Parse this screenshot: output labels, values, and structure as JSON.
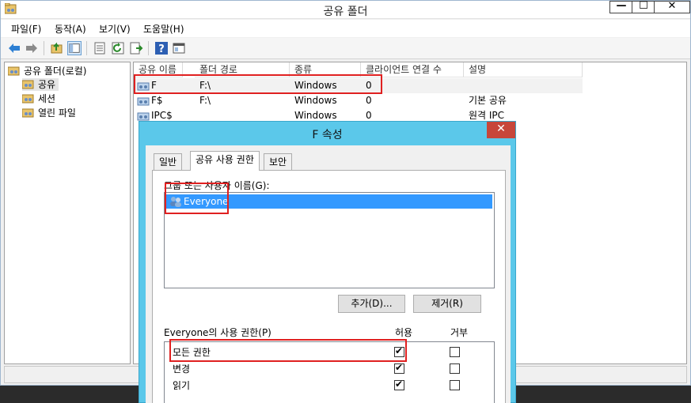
{
  "window": {
    "title": "공유 폴더"
  },
  "window_buttons": {
    "minimize": "—",
    "maximize": "☐",
    "close": "✕"
  },
  "menu": [
    "파일(F)",
    "동작(A)",
    "보기(V)",
    "도움말(H)"
  ],
  "tree": {
    "root": "공유 폴더(로컬)",
    "items": [
      "공유",
      "세션",
      "열린 파일"
    ]
  },
  "list": {
    "columns": [
      "공유 이름",
      "폴더 경로",
      "종류",
      "클라이언트 연결 수",
      "설명"
    ],
    "rows": [
      {
        "name": "F",
        "path": "F:\\",
        "type": "Windows",
        "clients": "0",
        "desc": ""
      },
      {
        "name": "F$",
        "path": "F:\\",
        "type": "Windows",
        "clients": "0",
        "desc": "기본 공유"
      },
      {
        "name": "IPC$",
        "path": "",
        "type": "Windows",
        "clients": "0",
        "desc": "원격 IPC"
      }
    ]
  },
  "dialog": {
    "title": "F 속성",
    "close": "✕",
    "tabs": [
      "일반",
      "공유 사용 권한",
      "보안"
    ],
    "group_label": "그룹 또는 사용자 이름(G):",
    "users": [
      "Everyone"
    ],
    "add_button": "추가(D)...",
    "remove_button": "제거(R)",
    "perm_label": "Everyone의 사용 권한(P)",
    "allow_header": "허용",
    "deny_header": "거부",
    "permissions": [
      {
        "name": "모든 권한",
        "allow": true,
        "deny": false
      },
      {
        "name": "변경",
        "allow": true,
        "deny": false
      },
      {
        "name": "읽기",
        "allow": true,
        "deny": false
      }
    ]
  },
  "colors": {
    "dialog_frame": "#5bc8ea",
    "selection": "#3399ff",
    "highlight_box": "#e02020"
  }
}
